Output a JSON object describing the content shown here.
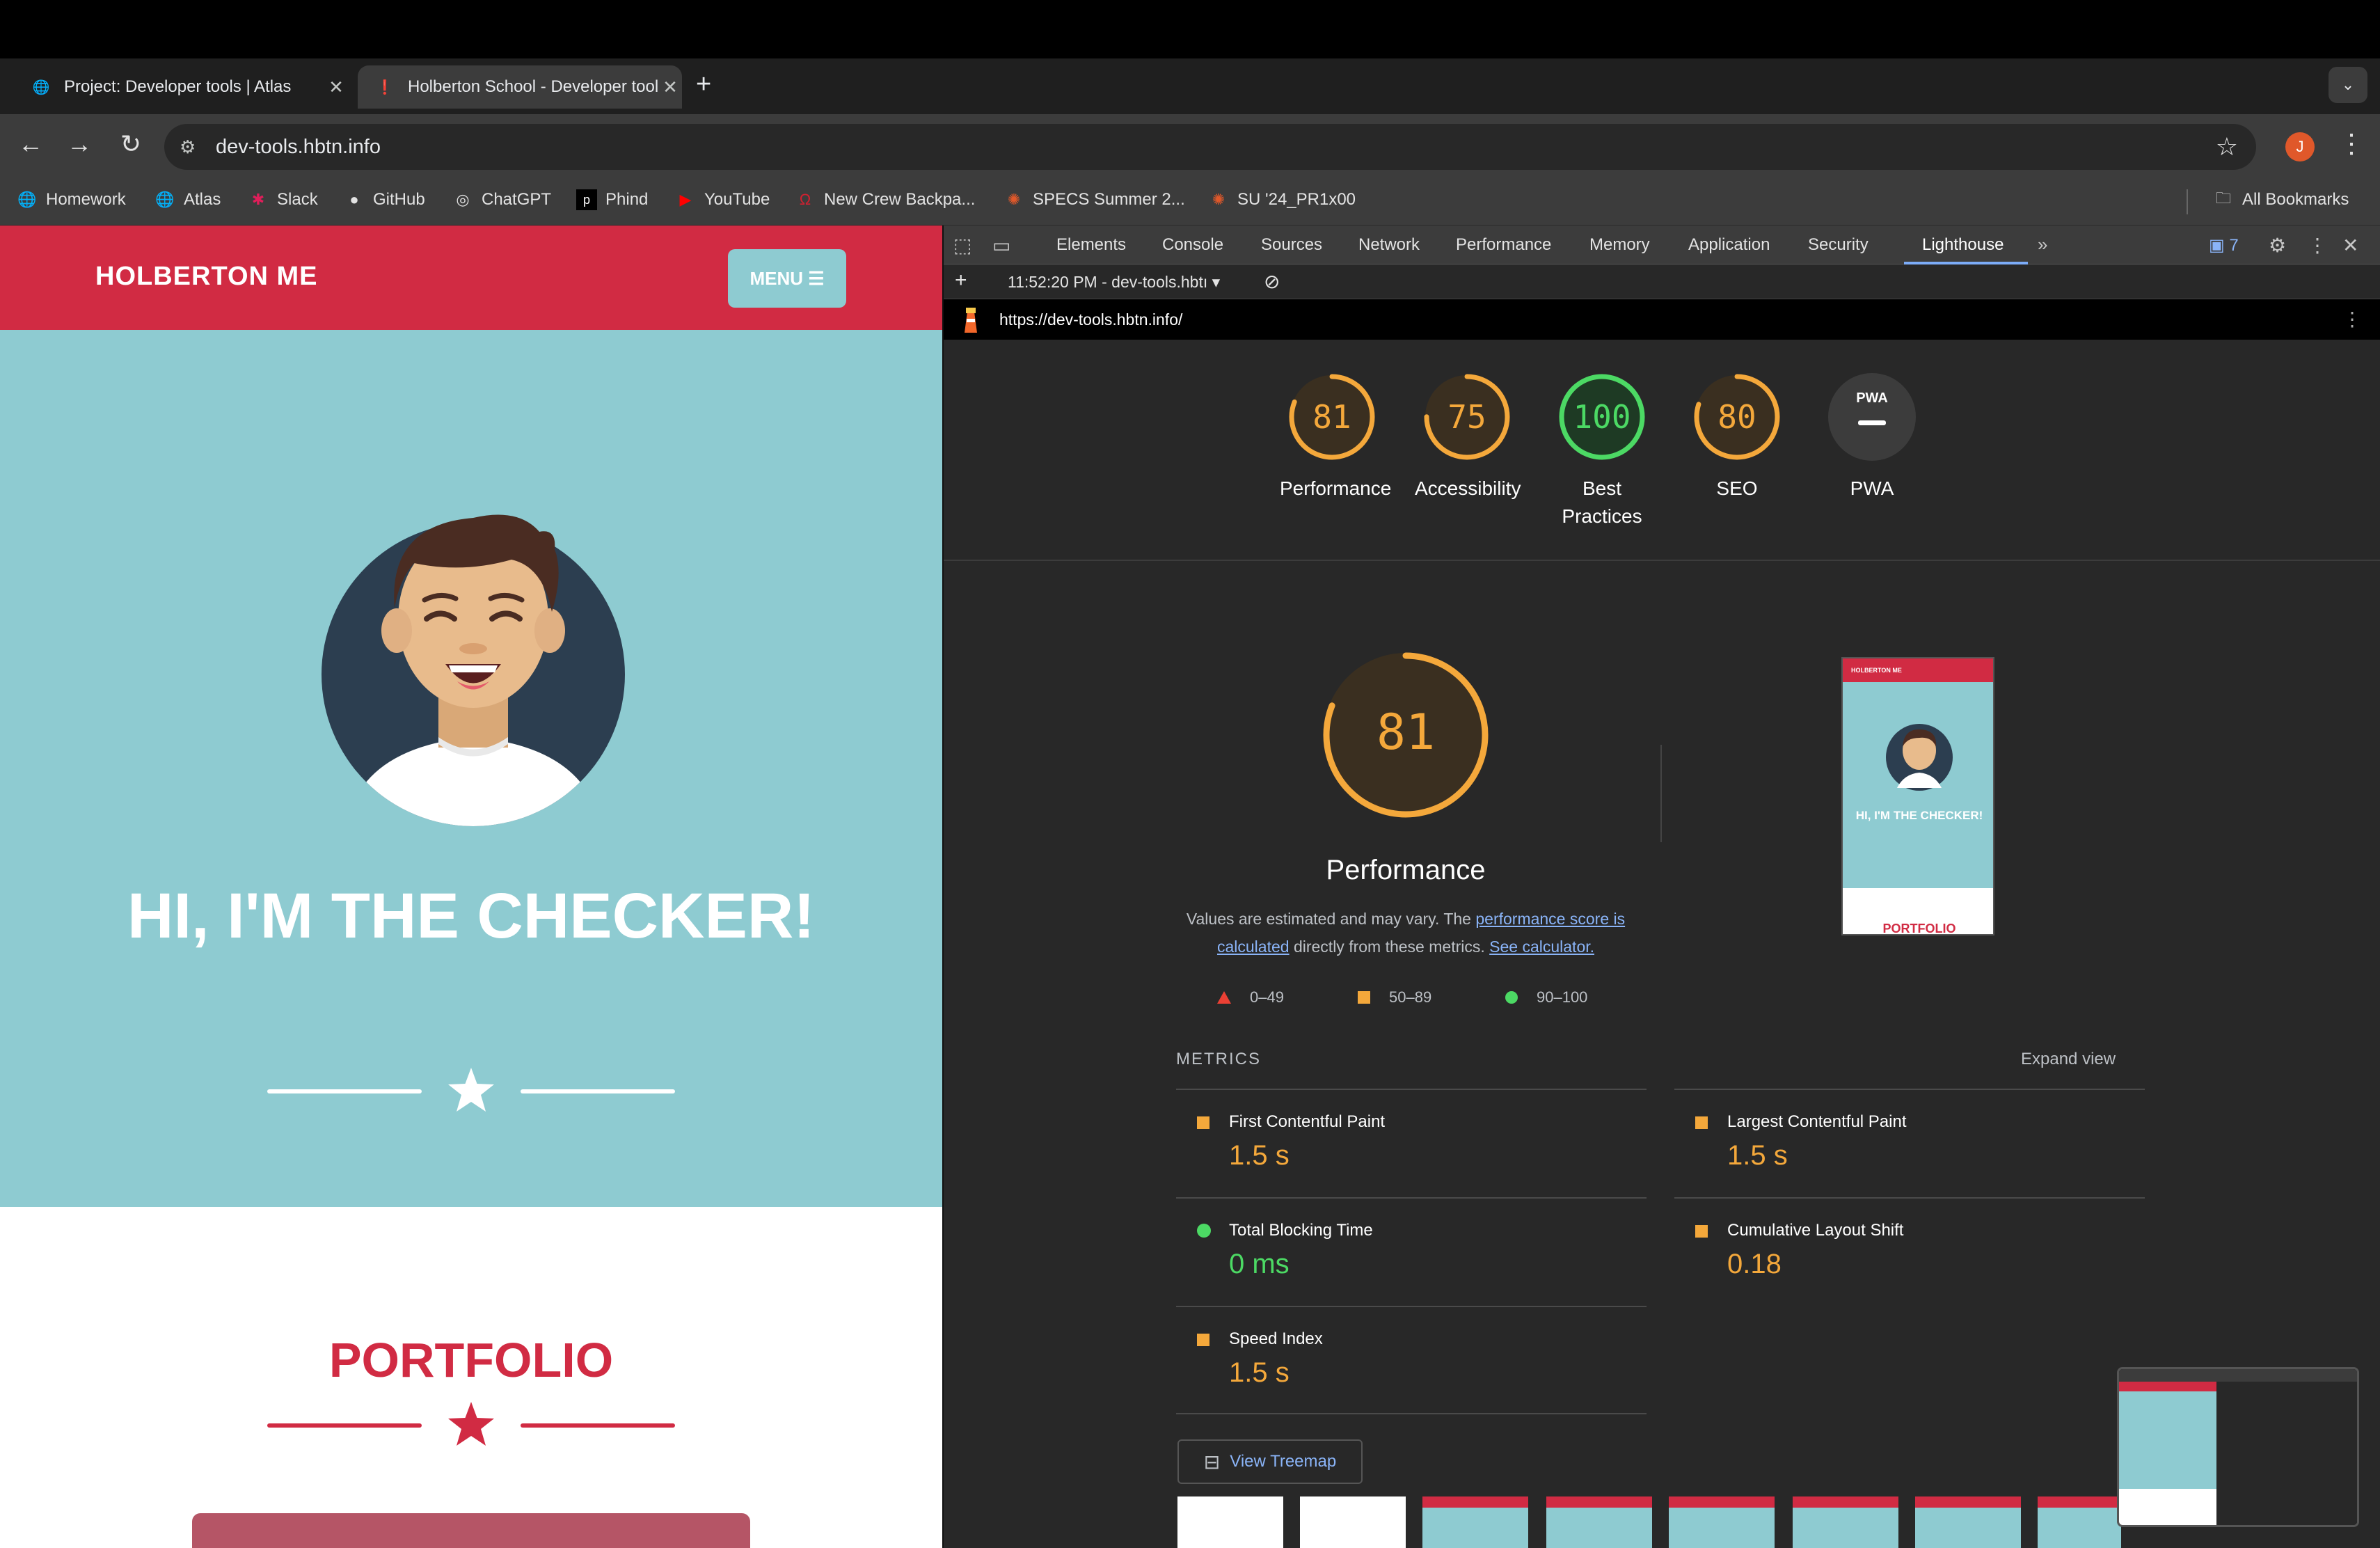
{
  "browser": {
    "tabs": [
      {
        "title": "Project: Developer tools | Atlas",
        "active": false
      },
      {
        "title": "Holberton School - Developer tools",
        "active": true
      }
    ],
    "address": "dev-tools.hbtn.info",
    "profile_initial": "J",
    "bookmarks": [
      "Homework",
      "Atlas",
      "Slack",
      "GitHub",
      "ChatGPT",
      "Phind",
      "YouTube",
      "New Crew Backpa...",
      "SPECS Summer 2...",
      "SU '24_PR1x00"
    ],
    "all_bookmarks": "All Bookmarks"
  },
  "page": {
    "brand": "HOLBERTON ME",
    "menu_label": "MENU ☰",
    "hero_title": "HI, I'M THE CHECKER!",
    "portfolio_title": "PORTFOLIO",
    "colors": {
      "primary": "#d12b43",
      "hero": "#8ecbd1"
    }
  },
  "devtools": {
    "tabs": [
      "Elements",
      "Console",
      "Sources",
      "Network",
      "Performance",
      "Memory",
      "Application",
      "Security",
      "Lighthouse"
    ],
    "active_tab": "Lighthouse",
    "issues_count": "7",
    "report_selector": "11:52:20 PM - dev-tools.hbtı",
    "report_url": "https://dev-tools.hbtn.info/"
  },
  "lighthouse": {
    "scores": [
      {
        "label": "Performance",
        "value": 81,
        "status": "average"
      },
      {
        "label": "Accessibility",
        "value": 75,
        "status": "average"
      },
      {
        "label": "Best Practices",
        "value": 100,
        "status": "pass"
      },
      {
        "label": "SEO",
        "value": 80,
        "status": "average"
      },
      {
        "label": "PWA",
        "value": null,
        "status": "na"
      }
    ],
    "pwa_badge": "PWA",
    "main": {
      "score": 81,
      "title": "Performance",
      "desc_part1": "Values are estimated and may vary. The ",
      "desc_link1": "performance score is calculated",
      "desc_part2": " directly from these metrics. ",
      "desc_link2": "See calculator."
    },
    "legend": [
      "0–49",
      "50–89",
      "90–100"
    ],
    "metrics_header": "METRICS",
    "expand_label": "Expand view",
    "metrics": [
      {
        "name": "First Contentful Paint",
        "value": "1.5 s",
        "status": "average"
      },
      {
        "name": "Largest Contentful Paint",
        "value": "1.5 s",
        "status": "average"
      },
      {
        "name": "Total Blocking Time",
        "value": "0 ms",
        "status": "pass"
      },
      {
        "name": "Cumulative Layout Shift",
        "value": "0.18",
        "status": "average"
      },
      {
        "name": "Speed Index",
        "value": "1.5 s",
        "status": "average"
      }
    ],
    "treemap_label": "View Treemap",
    "screenshot": {
      "brand": "HOLBERTON ME",
      "title": "HI, I'M THE CHECKER!",
      "portfolio": "PORTFOLIO"
    },
    "colors": {
      "average": "#f4a83b",
      "pass": "#4cd964",
      "fail": "#eb4034",
      "ring_bg": "#3a2f20"
    }
  }
}
